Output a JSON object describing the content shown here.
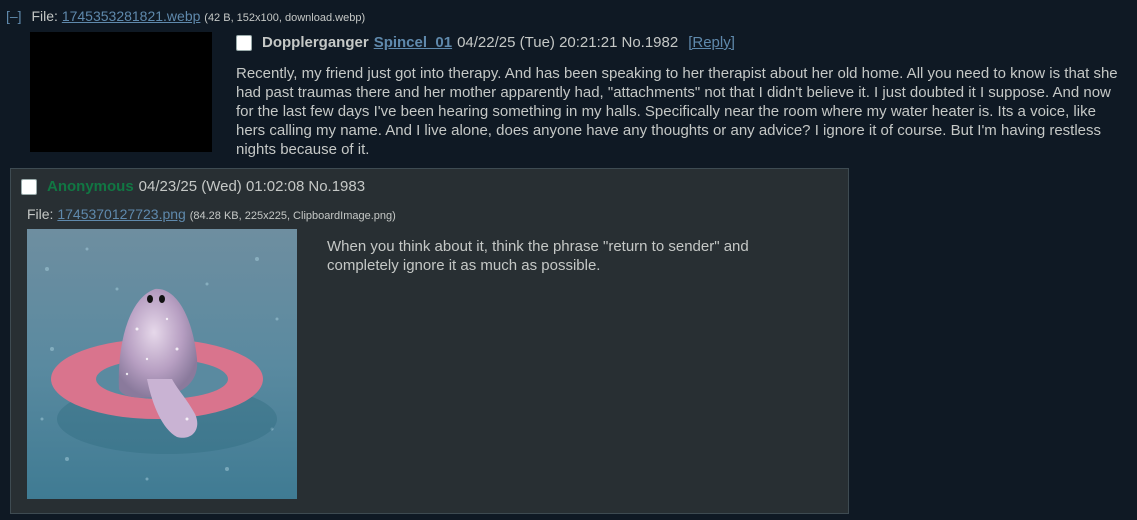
{
  "op": {
    "toggle": "[–]",
    "file_label": "File:",
    "file_name": "1745353281821.webp",
    "file_meta": "(42 B, 152x100, download.webp)",
    "name": "Dopplerganger",
    "tripcode": "Spincel_01",
    "date": "04/22/25 (Tue) 20:21:21",
    "post_no": "No.1982",
    "reply_link": "[Reply]",
    "body": "Recently, my friend just got into therapy. And has been speaking to her therapist about her old home. All you need to know is that she had past traumas there and her mother apparently had, \"attachments\" not that I didn't believe it. I just doubted it I suppose. And now for the last few days I've been hearing something in my halls. Specifically near the room where my water heater is. Its a voice, like hers calling my name. And I live alone, does anyone have any thoughts or any advice? I ignore it of course. But I'm having restless nights because of it."
  },
  "reply": {
    "name": "Anonymous",
    "date": "04/23/25 (Wed) 01:02:08",
    "post_no": "No.1983",
    "file_label": "File:",
    "file_name": "1745370127723.png",
    "file_meta": "(84.28 KB, 225x225, ClipboardImage.png)",
    "body": "When you think about it, think the phrase \"return to sender\" and completely ignore it as much as possible."
  },
  "colors": {
    "background": "#0f1924",
    "reply_background": "#282f33",
    "link": "#5f89ac",
    "anon_name": "#117743",
    "text": "#c5c8c6"
  }
}
